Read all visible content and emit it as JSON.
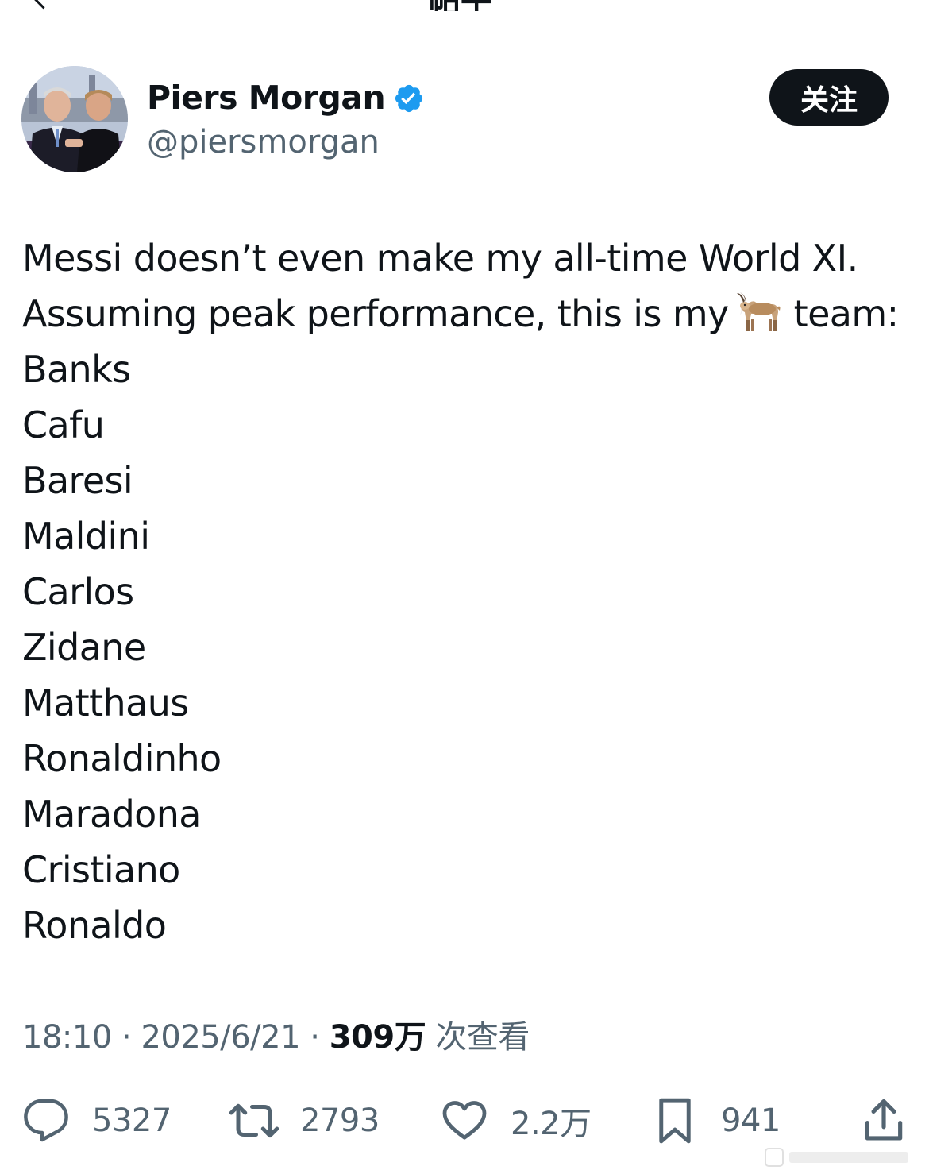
{
  "header": {
    "title": "帖子"
  },
  "author": {
    "display_name": "Piers Morgan",
    "handle": "@piersmorgan",
    "verified": true
  },
  "follow_button": {
    "label": "关注"
  },
  "tweet": {
    "lines": [
      "Messi doesn’t even make my all-time World XI.",
      "Assuming peak performance, this is my",
      "team:",
      "Banks",
      "Cafu",
      "Baresi",
      "Maldini",
      "Carlos",
      "Zidane",
      "Matthaus",
      "Ronaldinho",
      "Maradona",
      "Cristiano",
      "Ronaldo"
    ],
    "emoji": "goat-emoji"
  },
  "meta": {
    "time": "18:10",
    "separator": "·",
    "date": "2025/6/21",
    "views_count": "309万",
    "views_label": "次查看"
  },
  "actions": {
    "replies": "5327",
    "reposts": "2793",
    "likes": "2.2万",
    "bookmarks": "941"
  },
  "colors": {
    "text_primary": "#0f1419",
    "text_secondary": "#536471",
    "verified_blue": "#1d9bf0",
    "button_bg": "#0f1419"
  }
}
